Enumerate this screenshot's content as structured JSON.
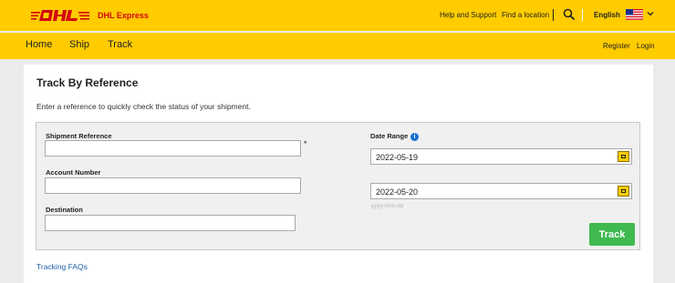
{
  "header": {
    "brand": "DHL Express",
    "links": [
      "Help and Support",
      "Find a location"
    ],
    "language": "English"
  },
  "nav": {
    "items": [
      "Home",
      "Ship",
      "Track"
    ],
    "register": "Register",
    "login": "Login"
  },
  "page": {
    "title": "Track By Reference",
    "subtitle": "Enter a reference to quickly check the status of your shipment.",
    "tracking_faqs": "Tracking FAQs"
  },
  "form": {
    "shipment_reference_label": "Shipment Reference",
    "shipment_reference_value": "",
    "required_mark": "*",
    "account_number_label": "Account Number",
    "account_number_value": "",
    "destination_label": "Destination",
    "destination_value": "",
    "date_range_label": "Date Range",
    "info_icon": "i",
    "date_from": "2022-05-19",
    "date_to": "2022-05-20",
    "date_hint": "yyyy-mm-dd",
    "track_button": "Track"
  },
  "colors": {
    "brand_yellow": "#ffcc00",
    "brand_red": "#d40511",
    "track_green": "#3fb950",
    "link_blue": "#1f5fa8"
  }
}
